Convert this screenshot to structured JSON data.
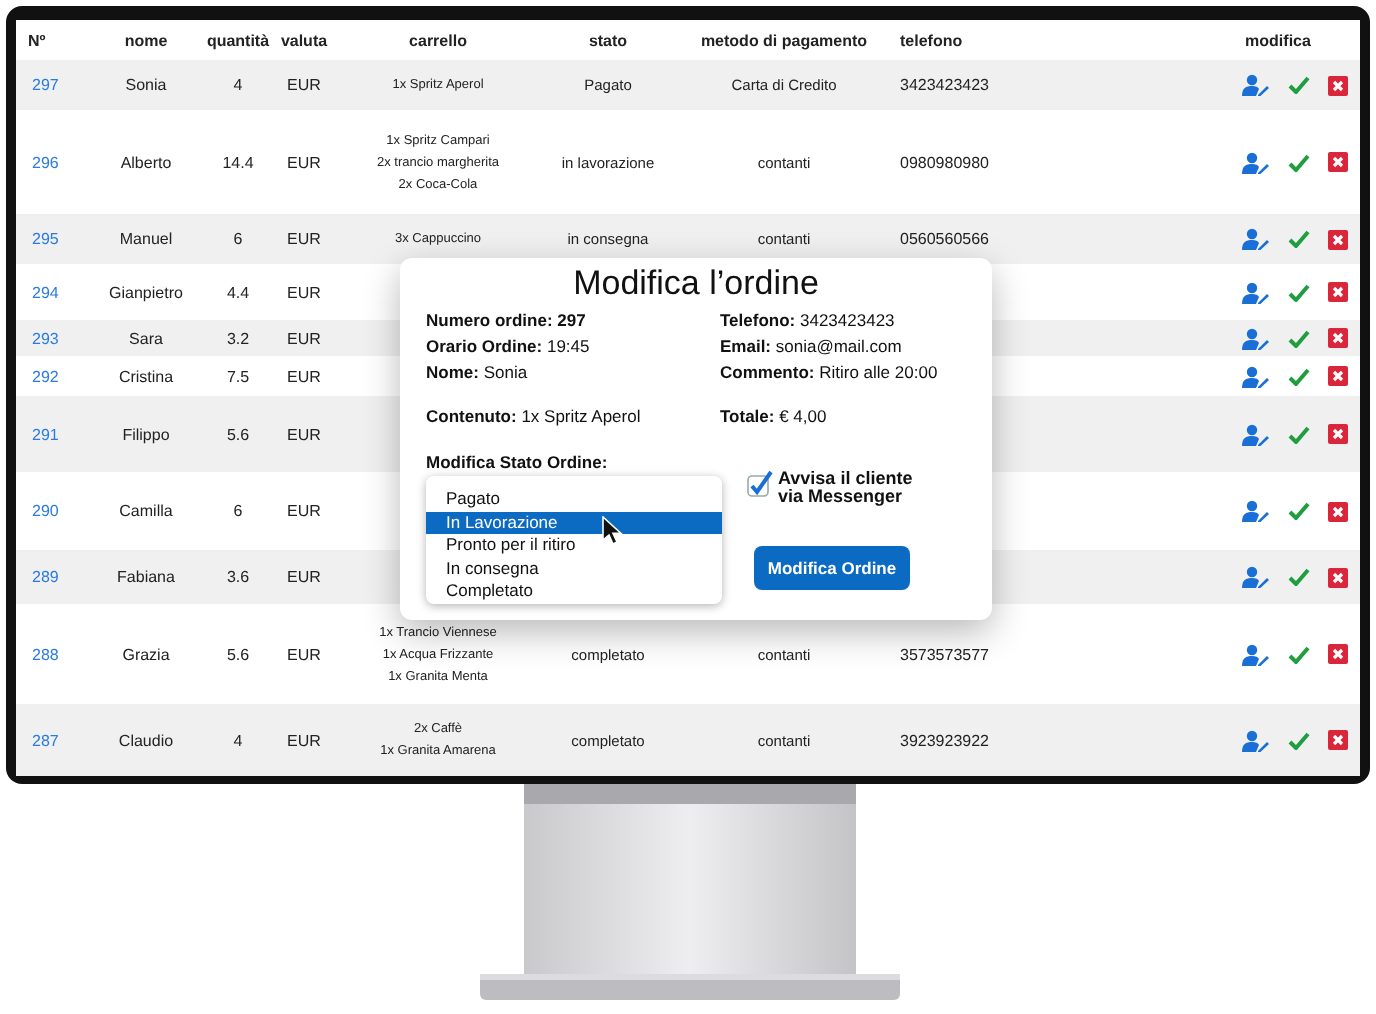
{
  "table": {
    "columns": [
      "Nº",
      "nome",
      "quantità",
      "valuta",
      "carrello",
      "stato",
      "metodo di pagamento",
      "telefono",
      "modifica"
    ],
    "rows": [
      {
        "number": "297",
        "name": "Sonia",
        "quantity": "4",
        "currency": "EUR",
        "cart": [
          "1x Spritz Aperol"
        ],
        "status": "Pagato",
        "payment": "Carta di Credito",
        "phone": "3423423423"
      },
      {
        "number": "296",
        "name": "Alberto",
        "quantity": "14.4",
        "currency": "EUR",
        "cart": [
          "1x Spritz Campari",
          "2x trancio margherita",
          "2x Coca-Cola"
        ],
        "status": "in lavorazione",
        "payment": "contanti",
        "phone": "0980980980"
      },
      {
        "number": "295",
        "name": "Manuel",
        "quantity": "6",
        "currency": "EUR",
        "cart": [
          "3x Cappuccino"
        ],
        "status": "in consegna",
        "payment": "contanti",
        "phone": "0560560566"
      },
      {
        "number": "294",
        "name": "Gianpietro",
        "quantity": "4.4",
        "currency": "EUR"
      },
      {
        "number": "293",
        "name": "Sara",
        "quantity": "3.2",
        "currency": "EUR"
      },
      {
        "number": "292",
        "name": "Cristina",
        "quantity": "7.5",
        "currency": "EUR"
      },
      {
        "number": "291",
        "name": "Filippo",
        "quantity": "5.6",
        "currency": "EUR"
      },
      {
        "number": "290",
        "name": "Camilla",
        "quantity": "6",
        "currency": "EUR"
      },
      {
        "number": "289",
        "name": "Fabiana",
        "quantity": "3.6",
        "currency": "EUR"
      },
      {
        "number": "288",
        "name": "Grazia",
        "quantity": "5.6",
        "currency": "EUR",
        "cart": [
          "1x Trancio Viennese",
          "1x Acqua Frizzante",
          "1x Granita Menta"
        ],
        "status": "completato",
        "payment": "contanti",
        "phone": "3573573577"
      },
      {
        "number": "287",
        "name": "Claudio",
        "quantity": "4",
        "currency": "EUR",
        "cart": [
          "2x Caffè",
          "1x Granita Amarena"
        ],
        "status": "completato",
        "payment": "contanti",
        "phone": "3923923922"
      }
    ]
  },
  "modal": {
    "title": "Modifica l’ordine",
    "left_fields": [
      {
        "label": "Numero ordine:",
        "value": "**297**"
      },
      {
        "label": "Orario Ordine:",
        "value": "19:45"
      },
      {
        "label": "Nome:",
        "value": "Sonia"
      }
    ],
    "right_fields": [
      {
        "label": "Telefono:",
        "value": "3423423423"
      },
      {
        "label": "Email:",
        "value": "sonia@mail.com"
      },
      {
        "label": "Commento:",
        "value": "Ritiro alle 20:00"
      }
    ],
    "content": {
      "label": "Contenuto:",
      "value": "1x Spritz Aperol"
    },
    "total": {
      "label": "Totale:",
      "value": "€ 4,00"
    },
    "status_label": "Modifica Stato Ordine:",
    "status_options": [
      {
        "label": "Pagato",
        "selected": false
      },
      {
        "label": "In Lavorazione",
        "selected": true
      },
      {
        "label": "Pronto per il ritiro",
        "selected": false
      },
      {
        "label": "In consegna",
        "selected": false
      },
      {
        "label": "Completato",
        "selected": false
      }
    ],
    "notify": {
      "label_lines": [
        "Avvisa il cliente",
        "via Messenger"
      ],
      "checked": true
    },
    "submit_button": "Modifica Ordine"
  }
}
